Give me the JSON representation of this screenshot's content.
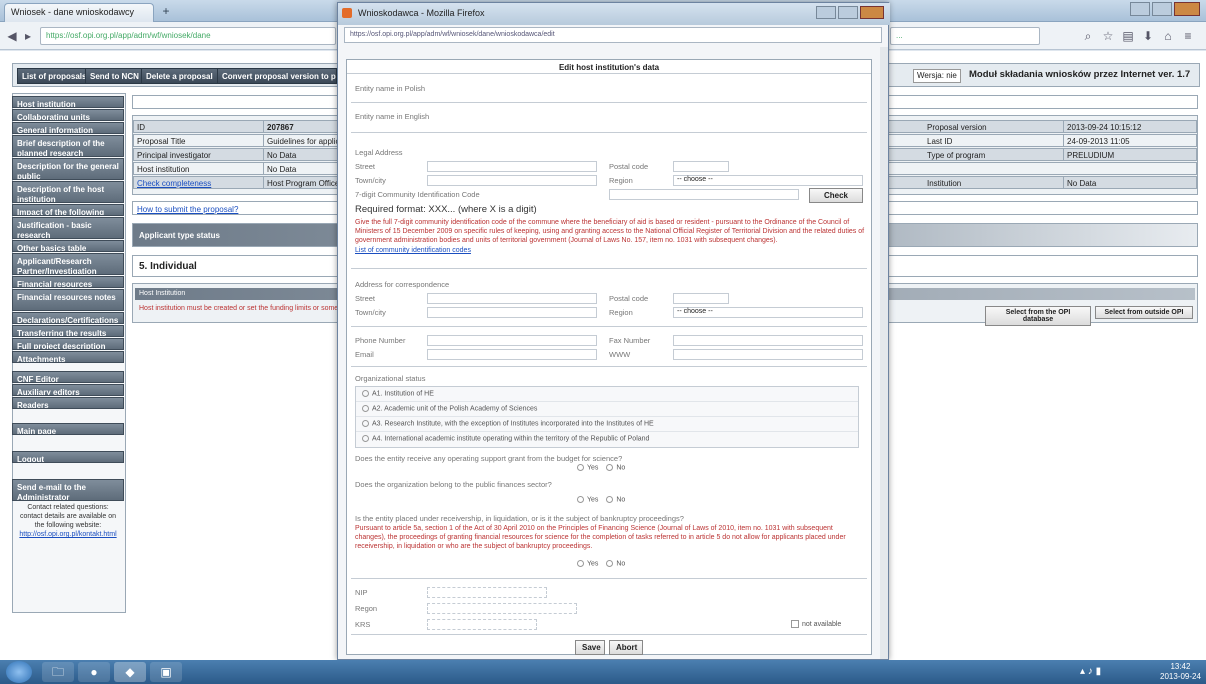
{
  "browser": {
    "tab1": "Wniosek - dane wnioskodawcy",
    "tab_add": "+",
    "url": "https://osf.opi.org.pl/app/adm/wf/wniosek/dane",
    "right_url_tail": "...",
    "nav_icons": [
      "back-icon",
      "forward-icon",
      "home-icon",
      "bookmark-icon",
      "download-icon",
      "menu-icon"
    ]
  },
  "topbar": {
    "buttons": [
      "List of proposals",
      "Send to NCN",
      "Delete a proposal",
      "Convert proposal version to pdf"
    ],
    "lang_label": "Wersja: nie",
    "app_title": "Moduł składania wniosków przez Internet ver. 1.7"
  },
  "sidebar": {
    "items": [
      "Host institution",
      "Collaborating units",
      "General information",
      "Brief description of the planned research",
      "Description for the general public",
      "Description of the host institution",
      "Impact of the following",
      "Justification - basic research",
      "Other basics table",
      "Applicant/Research Partner/Investigation",
      "Financial resources",
      "Financial resources notes",
      "Declarations/Certifications",
      "Transferring the results",
      "Full project description",
      "Attachments"
    ],
    "section2": [
      "CNF Editor",
      "Auxiliary editors",
      "Readers"
    ],
    "main_page": "Main page",
    "logout": "Logout",
    "send_email": "Send e-mail to the Administrator",
    "contact_text": "Contact related questions: contact details are available on the following website:",
    "contact_link": "http://osf.opi.org.pl/kontakt.html"
  },
  "main": {
    "row1": {
      "c1": "ID",
      "c2": "207867"
    },
    "row2": {
      "c1": "Proposal Title",
      "c2": "Guidelines for applicant"
    },
    "row3": {
      "c1": "Principal investigator",
      "c2": "No Data"
    },
    "row4": {
      "c1": "Host institution",
      "c2": "No Data"
    },
    "row5": {
      "c1": "Check completeness",
      "c2": "Host Program Office"
    },
    "right": {
      "r1": {
        "k": "Proposal version",
        "v": "2013-09-24 10:15:12"
      },
      "r2": {
        "k": "Last ID",
        "v": "24-09-2013 11:05"
      },
      "r3": {
        "k": "Type of program",
        "v": "PRELUDIUM"
      },
      "r5": {
        "k": "Institution",
        "v": "No Data"
      }
    },
    "how_to_submit": "How to submit the proposal?",
    "applicant_type": "Applicant type status",
    "section_title": "5. Individual",
    "host_institution": "Host Institution",
    "warning": "Host institution must be created or set the funding limits or something else",
    "select_from_db": "Select from the OPI database",
    "select_outside": "Select from outside OPI"
  },
  "popup": {
    "window_title": "Wnioskodawca - Mozilla Firefox",
    "url": "https://osf.opi.org.pl/app/adm/wf/wniosek/dane/wnioskodawca/edit",
    "form_title": "Edit host institution's data",
    "entity_pl": "Entity name in Polish",
    "entity_en": "Entity name in English",
    "legal_address": "Legal Address",
    "street": "Street",
    "postal": "Postal code",
    "town": "Town/city",
    "region": "Region",
    "choose": "-- choose --",
    "regon_code": "7-digit Community Identification Code",
    "check": "Check",
    "required_format": "Required format: XXX... (where X is a digit)",
    "regon_note": "Give the full 7-digit community identification code of the commune where the beneficiary of aid is based or resident - pursuant to the Ordinance of the Council of Ministers of 15 December 2009 on specific rules of keeping, using and granting access to the National Official Register of Territorial Division and the related duties of government administration bodies and units of territorial government (Journal of Laws No. 157, item no. 1031 with subsequent changes).",
    "regon_link": "List of community identification codes",
    "corr_address": "Address for correspondence",
    "phone": "Phone Number",
    "fax": "Fax Number",
    "email": "Email",
    "www": "WWW",
    "org_status": "Organizational status",
    "status_options": [
      "A1. Institution of HE",
      "A2. Academic unit of the Polish Academy of Sciences",
      "A3. Research Institute, with the exception of Institutes incorporated into the Institutes of HE",
      "A4. International academic institute operating within the territory of the Republic of Poland"
    ],
    "q1": "Does the entity receive any operating support grant from the budget for science?",
    "q2": "Does the organization belong to the public finances sector?",
    "q3": "Is the entity placed under receivership, in liquidation, or is it the subject of bankruptcy proceedings?",
    "q3_note": "Pursuant to article 5a, section 1 of the Act of 30 April 2010 on the Principles of Financing Science (Journal of Laws of 2010, item no. 1031 with subsequent changes), the proceedings of granting financial resources for science for the completion of tasks referred to in article 5 do not allow for applicants placed under receivership, in liquidation or who are the subject of bankruptcy proceedings.",
    "yes": "Yes",
    "no": "No",
    "nip": "NIP",
    "regon": "Regon",
    "krs": "KRS",
    "not_available": "not available",
    "save": "Save",
    "abort": "Abort"
  },
  "taskbar": {
    "clock_time": "13:42",
    "clock_date": "2013-09-24"
  }
}
